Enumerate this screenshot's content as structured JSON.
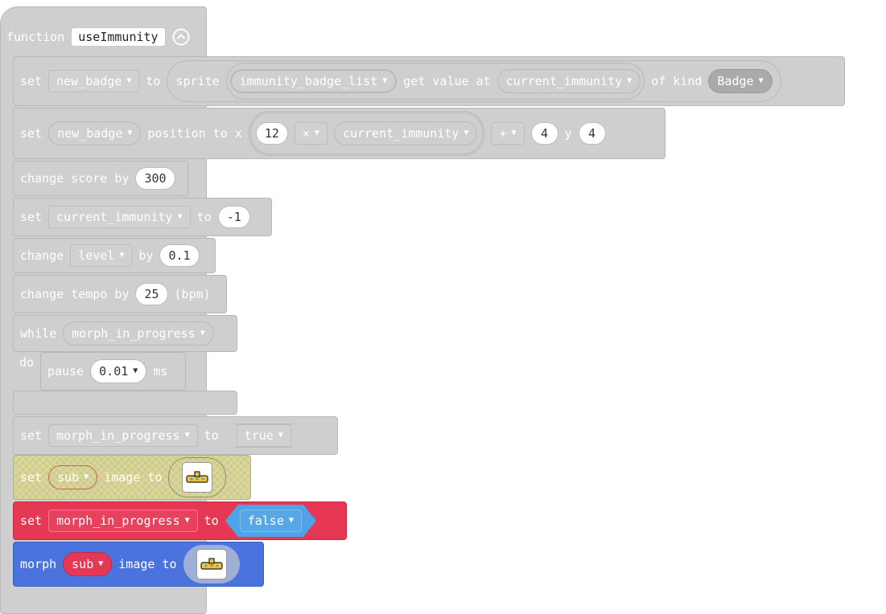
{
  "function_block": {
    "keyword": "function",
    "name": "useImmunity",
    "collapse_icon": "chevron-up-circle-icon"
  },
  "blocks": {
    "set_badge": {
      "set": "set",
      "var": "new_badge",
      "to": "to",
      "sprite": "sprite",
      "list": "immunity_badge_list",
      "get_value_at": "get value at",
      "index": "current_immunity",
      "of_kind": "of kind",
      "kind": "Badge"
    },
    "set_position": {
      "set": "set",
      "var": "new_badge",
      "position_to_x": "position to x",
      "a": "12",
      "op": "×",
      "b": "current_immunity",
      "op2": "+",
      "c": "4",
      "y": "y",
      "yval": "4"
    },
    "change_score": {
      "label": "change score by",
      "value": "300"
    },
    "set_immunity": {
      "set": "set",
      "var": "current_immunity",
      "to": "to",
      "value": "-1"
    },
    "change_level": {
      "change": "change",
      "var": "level",
      "by": "by",
      "value": "0.1"
    },
    "change_tempo": {
      "label": "change tempo by",
      "value": "25",
      "unit": "(bpm)"
    },
    "while": {
      "keyword": "while",
      "cond": "morph_in_progress",
      "do": "do",
      "pause": "pause",
      "pause_value": "0.01",
      "ms": "ms"
    },
    "set_morph_true": {
      "set": "set",
      "var": "morph_in_progress",
      "to": "to",
      "value": "true"
    },
    "set_sub_image": {
      "set": "set",
      "var": "sub",
      "image_to": "image to",
      "sprite_icon": "sub-sprite-icon"
    },
    "set_morph_false": {
      "set": "set",
      "var": "morph_in_progress",
      "to": "to",
      "value": "false"
    },
    "morph": {
      "morph": "morph",
      "var": "sub",
      "image_to": "image to",
      "sprite_icon": "sub-sprite-icon"
    }
  },
  "colors": {
    "disabled": "#cfcfcf",
    "variables": "#e63755",
    "logic": "#4fa3e6",
    "morph": "#4b73de"
  }
}
